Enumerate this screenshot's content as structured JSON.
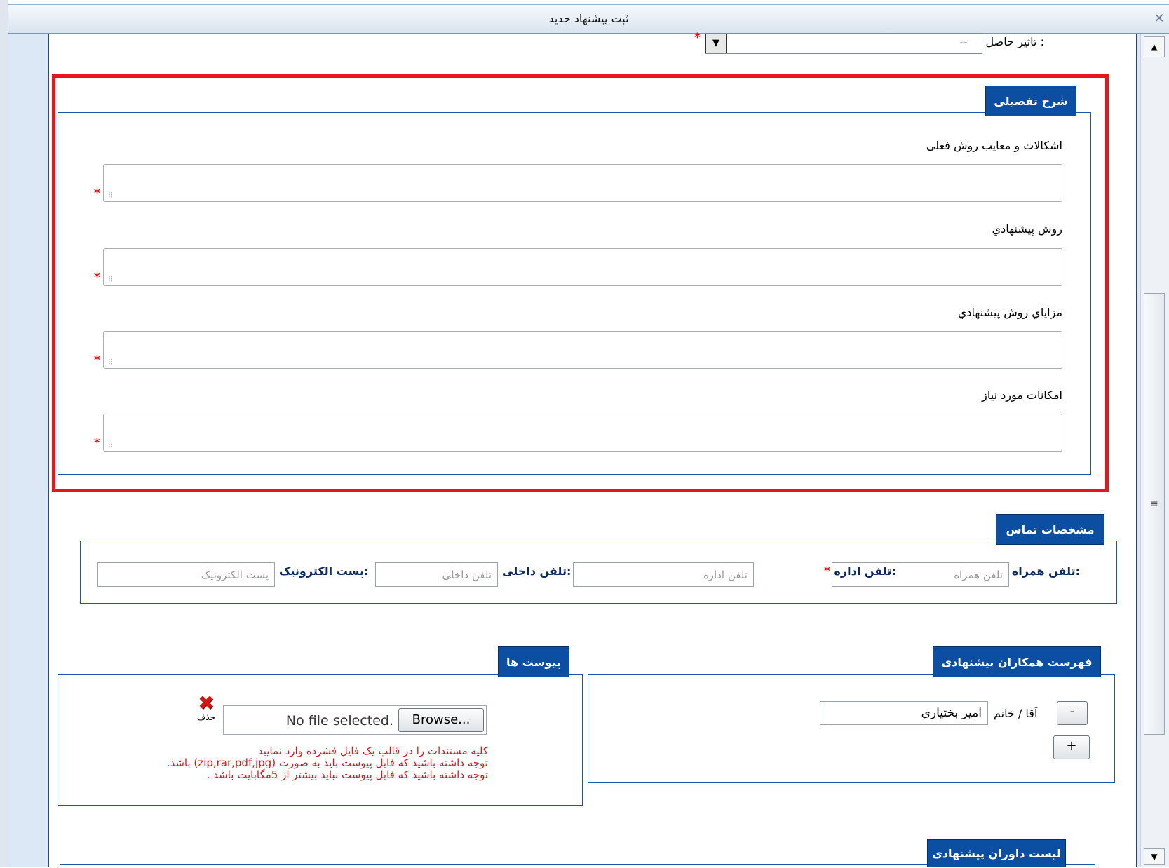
{
  "window": {
    "title": "ثبت پیشنهاد جدید",
    "close_glyph": "✕"
  },
  "top": {
    "impact_label": "تاثیر حاصل از اجرا :",
    "impact_value": "--",
    "required_mark": "*"
  },
  "detail": {
    "legend": "شرح تفصیلی",
    "fields": [
      {
        "label": "اشکالات و معایب روش فعلی"
      },
      {
        "label": "روش پیشنهادي"
      },
      {
        "label": "مزاياي روش پيشنهادي"
      },
      {
        "label": "امکانات مورد نیاز"
      }
    ],
    "required_mark": "*"
  },
  "contact": {
    "legend": "مشخصات تماس",
    "mobile_label": "تلفن همراه:",
    "mobile_placeholder": "تلفن همراه",
    "office_label": "تلفن اداره:",
    "office_required": "*",
    "office_placeholder": "تلفن اداره",
    "internal_label": "تلفن داخلی:",
    "internal_placeholder": "تلفن داخلی",
    "email_label": "پست الکترونیک:",
    "email_placeholder": "پست الکترونیک"
  },
  "colleagues": {
    "legend": "فهرست همکاران پیشنهادی",
    "minus_button": "-",
    "plus_button": "+",
    "title_label": "آقا / خانم",
    "name_value": "امير بختياري"
  },
  "attachments": {
    "legend": "پیوست ها",
    "delete_label": "حذف",
    "file_status": "No file selected.",
    "browse_label": "Browse...",
    "notes": [
      "کلیه مستندات را در قالب یک فایل فشرده وارد نمایید",
      "توجه داشته باشید که فایل پیوست باید به صورت (zip,rar,pdf,jpg)  باشد.",
      "توجه داشته باشید که فایل پیوست نباید بیشتر از 5مگابایت باشد ."
    ]
  },
  "reviewers": {
    "legend": "لیست داوران پیشنهادی"
  }
}
